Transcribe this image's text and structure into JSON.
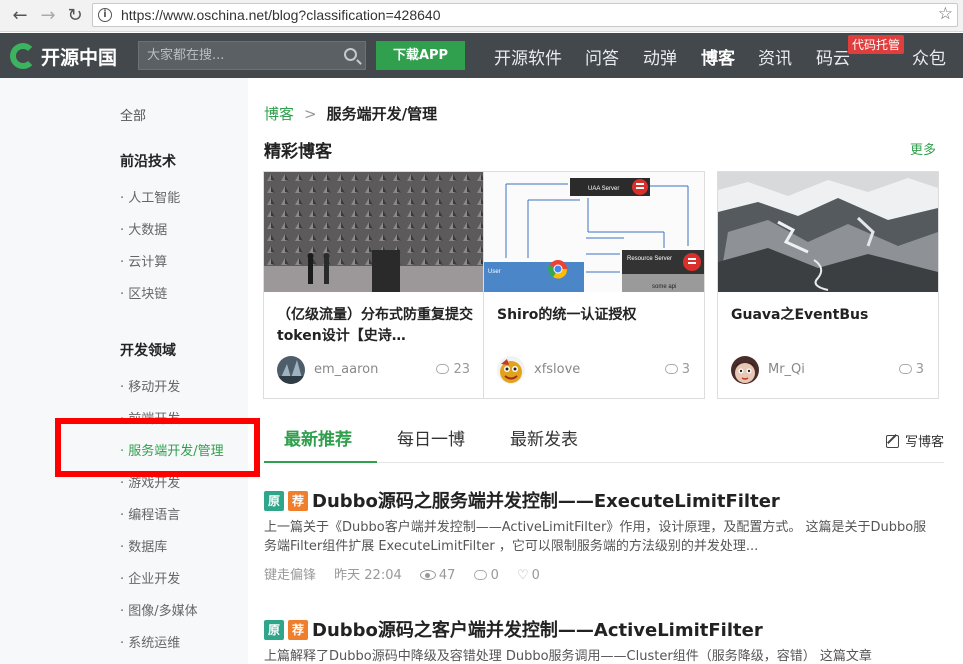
{
  "browser": {
    "url": "https://www.oschina.net/blog?classification=428640",
    "back": "←",
    "forward": "→",
    "reload": "↻",
    "info": "i",
    "star": "☆"
  },
  "header": {
    "brand": "开源中国",
    "search_placeholder": "大家都在搜...",
    "download_label": "下载APP",
    "nav": [
      "开源软件",
      "问答",
      "动弹",
      "博客",
      "资讯",
      "码云",
      "众包"
    ],
    "active_nav": "博客",
    "badge": "代码托管"
  },
  "sidebar": {
    "all": "全部",
    "group1": "前沿技术",
    "group1_items": [
      "· 人工智能",
      "· 大数据",
      "· 云计算",
      "· 区块链"
    ],
    "group2": "开发领域",
    "group2_items": [
      "· 移动开发",
      "· 前端开发",
      "· 服务端开发/管理",
      "· 游戏开发",
      "· 编程语言",
      "· 数据库",
      "· 企业开发",
      "· 图像/多媒体",
      "· 系统运维"
    ]
  },
  "breadcrumb": {
    "link": "博客",
    "sep": ">",
    "current": "服务端开发/管理"
  },
  "featured": {
    "title": "精彩博客",
    "more": "更多",
    "cards": [
      {
        "title": "（亿级流量）分布式防重复提交token设计【史诗…",
        "author": "em_aaron",
        "comments": "23"
      },
      {
        "title": "Shiro的统一认证授权",
        "author": "xfslove",
        "comments": "3"
      },
      {
        "title": "Guava之EventBus",
        "author": "Mr_Qi",
        "comments": "3"
      }
    ],
    "diagram_labels": {
      "uaa": "UAA Server",
      "resource": "Resource Server",
      "user": "User",
      "some": "some api"
    }
  },
  "tabs": {
    "items": [
      "最新推荐",
      "每日一博",
      "最新发表"
    ],
    "write": "写博客"
  },
  "posts": [
    {
      "badge1": "原",
      "badge2": "荐",
      "title": "Dubbo源码之服务端并发控制——ExecuteLimitFilter",
      "desc": "上一篇关于《Dubbo客户端并发控制——ActiveLimitFilter》作用，设计原理，及配置方式。 这篇是关于Dubbo服务端Filter组件扩展 ExecuteLimitFilter ，它可以限制服务端的方法级别的并发处理...",
      "author": "键走偏锋",
      "time": "昨天 22:04",
      "views": "47",
      "comments": "0",
      "likes": "0"
    },
    {
      "badge1": "原",
      "badge2": "荐",
      "title": "Dubbo源码之客户端并发控制——ActiveLimitFilter",
      "desc": "上篇解释了Dubbo源码中降级及容错处理 Dubbo服务调用——Cluster组件（服务降级，容错） 这篇文章"
    }
  ]
}
